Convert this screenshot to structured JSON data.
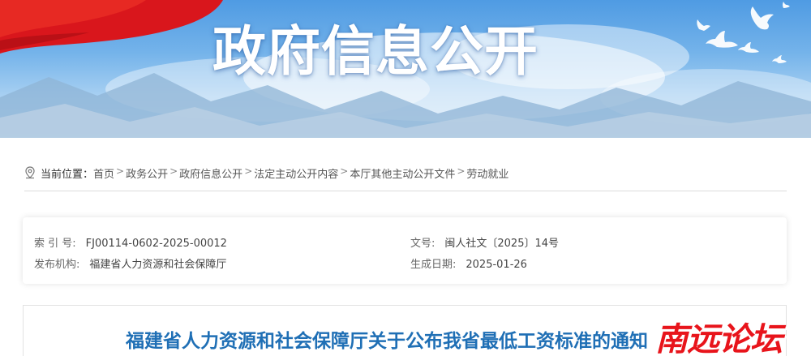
{
  "banner": {
    "title": "政府信息公开"
  },
  "breadcrumb": {
    "label": "当前位置：",
    "separator": ">",
    "items": [
      "首页",
      "政务公开",
      "政府信息公开",
      "法定主动公开内容",
      "本厅其他主动公开文件",
      "劳动就业"
    ]
  },
  "info": {
    "index_key": "索 引 号:",
    "index_value": "FJ00114-0602-2025-00012",
    "doc_key": "文号:",
    "doc_value": "闽人社文〔2025〕14号",
    "publisher_key": "发布机构:",
    "publisher_value": "福建省人力资源和社会保障厅",
    "date_key": "生成日期:",
    "date_value": "2025-01-26"
  },
  "article": {
    "title": "福建省人力资源和社会保障厅关于公布我省最低工资标准的通知"
  },
  "watermark": {
    "text": "南远论坛"
  },
  "colors": {
    "title_blue": "#1f6fb5",
    "flag_red": "#d9161c",
    "watermark_red": "#e8141b"
  }
}
